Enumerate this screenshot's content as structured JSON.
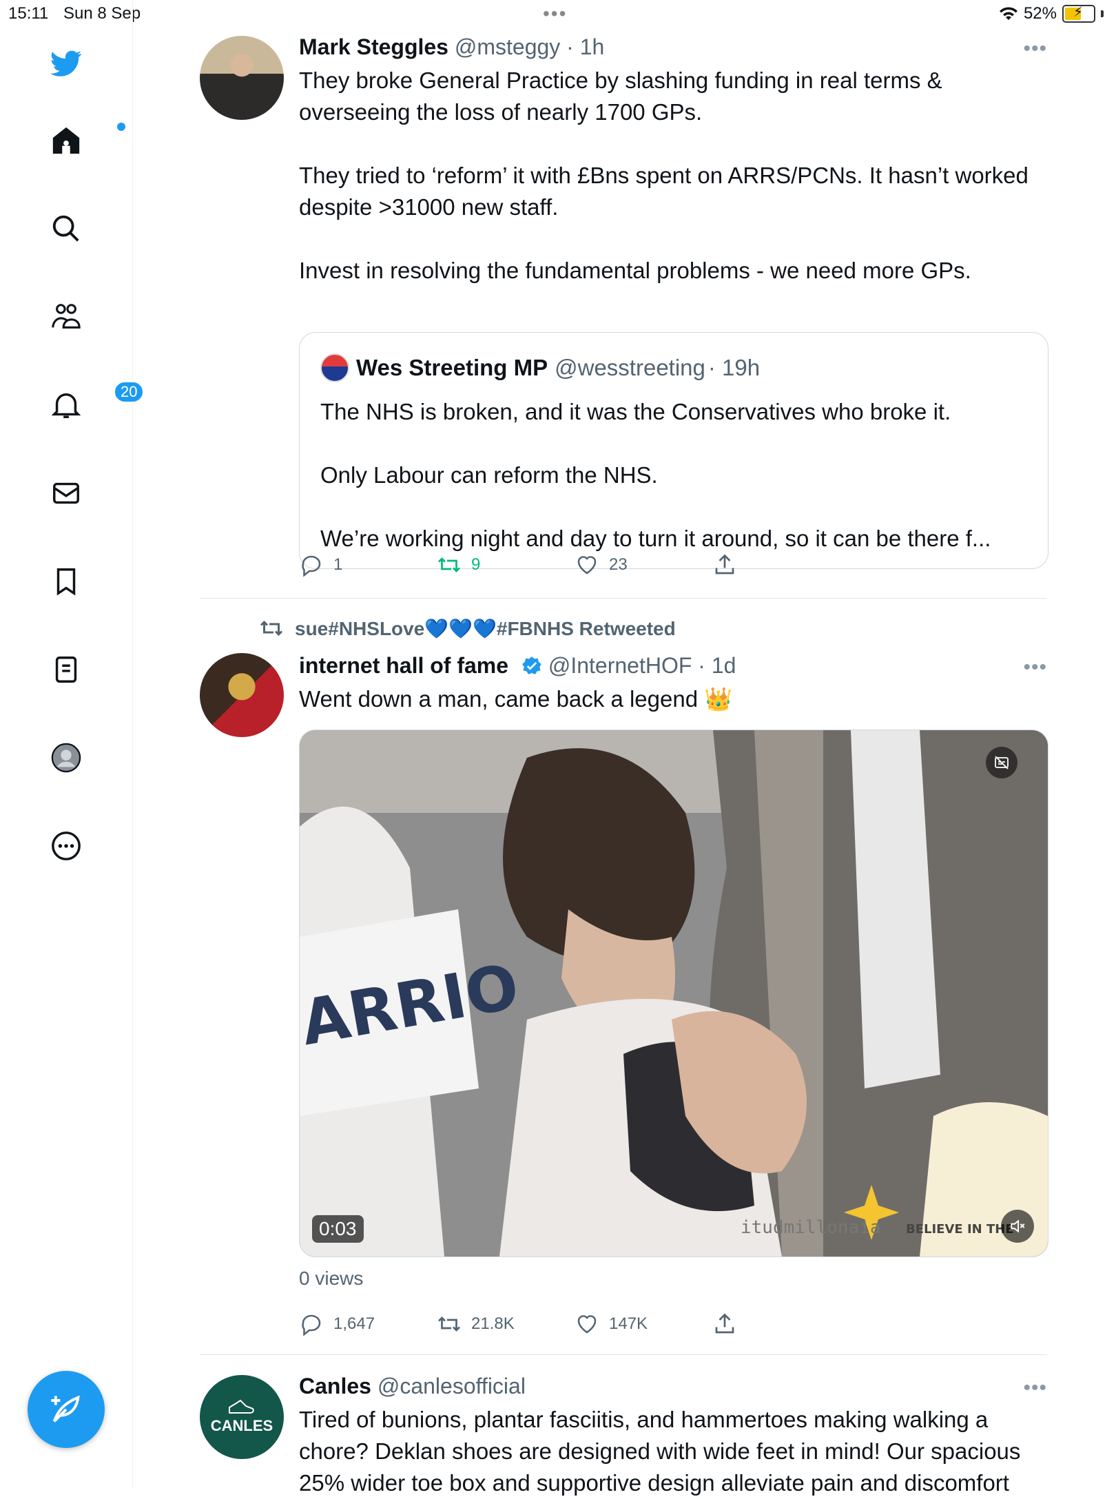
{
  "status_bar": {
    "time": "15:11",
    "date": "Sun 8 Sep",
    "battery": "52%"
  },
  "sidebar": {
    "notification_count": "20",
    "items": [
      "twitter-logo",
      "home-icon",
      "search-icon",
      "communities-icon",
      "notifications-icon",
      "messages-icon",
      "bookmarks-icon",
      "lists-icon",
      "profile-icon",
      "more-icon"
    ]
  },
  "tweets": [
    {
      "name": "Mark Steggles",
      "handle": "@msteggy",
      "time": "· 1h",
      "text": "They broke General Practice by slashing funding in real terms & overseeing the loss of nearly 1700 GPs.\n\nThey tried to ‘reform’ it with £Bns spent on ARRS/PCNs. It hasn’t worked despite >31000 new staff.\n\nInvest in resolving the fundamental problems - we need more GPs.",
      "quote": {
        "name": "Wes Streeting MP",
        "handle": "@wesstreeting",
        "time": "· 19h",
        "text": "The NHS is broken, and it was the Conservatives who broke it.\n\nOnly Labour can reform the NHS.\n\nWe’re working night and day to turn it around, so it can be there f..."
      },
      "replies": "1",
      "retweets": "9",
      "likes": "23"
    },
    {
      "retweeted_by": "sue#NHSLove💙💙💙#FBNHS Retweeted",
      "name": "internet hall of fame",
      "handle": "@InternetHOF",
      "time": "· 1d",
      "text": "Went down a man, came back a legend 👑",
      "video_time": "0:03",
      "views": "0 views",
      "replies": "1,647",
      "retweets": "21.8K",
      "likes": "147K"
    },
    {
      "name": "Canles",
      "handle": "@canlesofficial",
      "avatar_label": "CANLES",
      "text": "Tired of bunions, plantar fasciitis, and hammertoes making walking a chore? Deklan shoes are designed with wide feet in mind! Our spacious 25% wider toe box and supportive design alleviate pain and discomfort"
    }
  ],
  "colors": {
    "accent": "#1d9bf0",
    "retweet_green": "#00ba7c",
    "muted": "#536471"
  }
}
